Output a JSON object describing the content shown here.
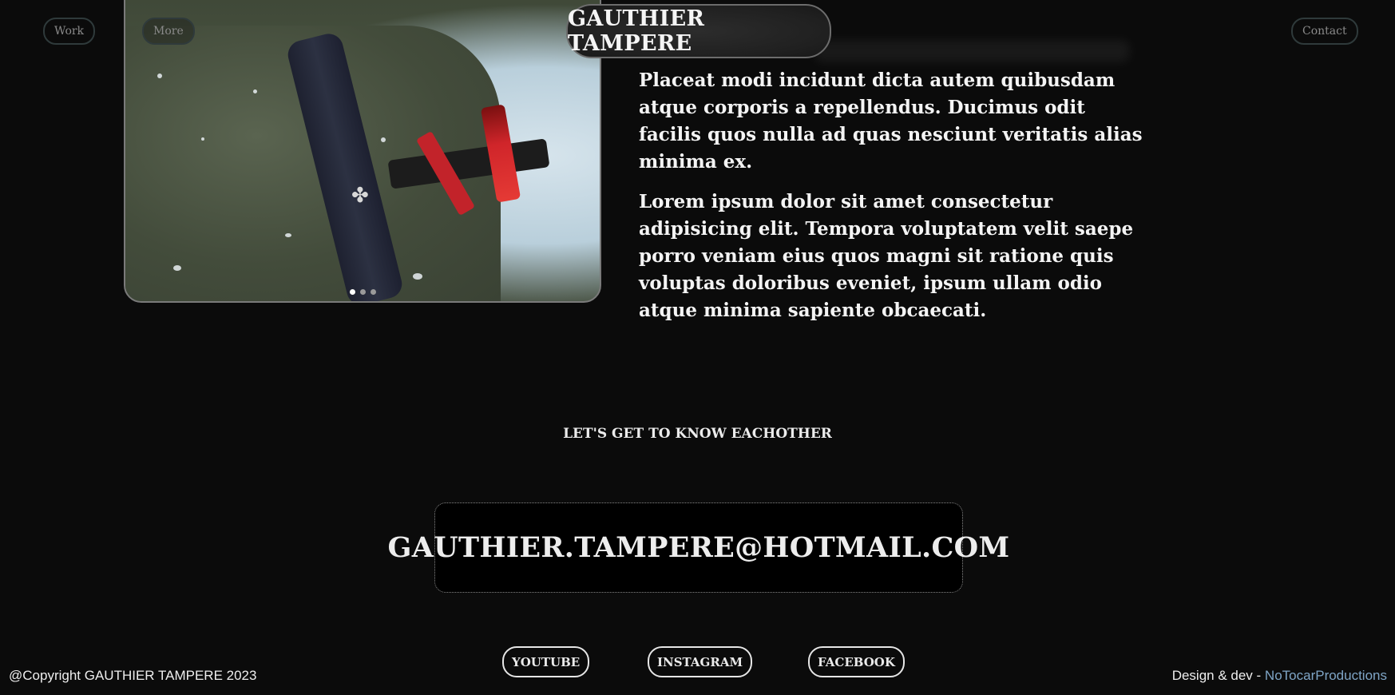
{
  "header": {
    "brand": "GAUTHIER TAMPERE",
    "nav_work": "Work",
    "nav_more": "More",
    "nav_contact": "Contact"
  },
  "gallery": {
    "slide_count": 3,
    "active_slide": 1
  },
  "about": {
    "paragraph_1": "Placeat modi incidunt dicta autem quibusdam atque corporis a repellendus. Ducimus odit facilis quos nulla ad quas nesciunt veritatis alias minima ex.",
    "paragraph_2": "Lorem ipsum dolor sit amet consectetur adipisicing elit. Tempora voluptatem velit saepe porro veniam eius quos magni sit ratione quis voluptas doloribus eveniet, ipsum ullam odio atque minima sapiente obcaecati."
  },
  "contact": {
    "title": "LET'S GET TO KNOW EACHOTHER",
    "email": "GAUTHIER.TAMPERE@HOTMAIL.COM"
  },
  "social": {
    "youtube": "YOUTUBE",
    "instagram": "INSTAGRAM",
    "facebook": "FACEBOOK"
  },
  "footer": {
    "copyright": "@Copyright GAUTHIER TAMPERE 2023",
    "credit_prefix": "Design & dev - ",
    "credit_link": "NoTocarProductions",
    "link_color": "#7fa5c6"
  }
}
